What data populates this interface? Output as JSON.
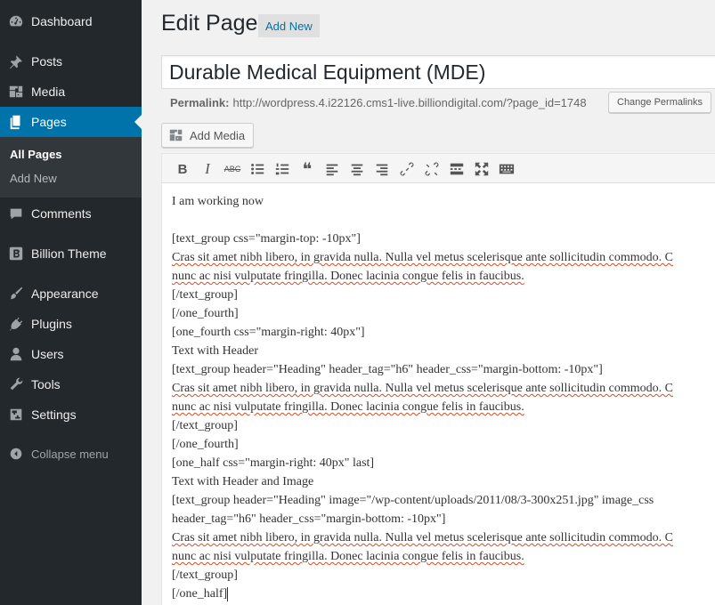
{
  "sidebar": {
    "items": [
      {
        "label": "Dashboard",
        "icon": "dashboard-icon"
      },
      {
        "label": "Posts",
        "icon": "pushpin-icon"
      },
      {
        "label": "Media",
        "icon": "media-icon"
      },
      {
        "label": "Pages",
        "icon": "pages-icon"
      },
      {
        "label": "Comments",
        "icon": "comment-icon"
      },
      {
        "label": "Billion Theme",
        "icon": "billion-b-icon"
      },
      {
        "label": "Appearance",
        "icon": "paintbrush-icon"
      },
      {
        "label": "Plugins",
        "icon": "plugin-icon"
      },
      {
        "label": "Users",
        "icon": "user-icon"
      },
      {
        "label": "Tools",
        "icon": "wrench-icon"
      },
      {
        "label": "Settings",
        "icon": "settings-sliders-icon"
      }
    ],
    "submenu": {
      "all_pages": "All Pages",
      "add_new": "Add New"
    },
    "collapse": "Collapse menu",
    "active_color": "#0073aa",
    "background": "#23282d"
  },
  "header": {
    "title": "Edit Page",
    "add_new": "Add New"
  },
  "post": {
    "title": "Durable Medical Equipment (MDE)",
    "permalink_label": "Permalink:",
    "permalink_url": "http://wordpress.4.i22126.cms1-live.billiondigital.com/?page_id=1748",
    "change_permalinks": "Change Permalinks"
  },
  "media": {
    "add_media": "Add Media"
  },
  "toolbar": {
    "buttons": [
      "bold",
      "italic",
      "strikethrough",
      "bulleted-list",
      "numbered-list",
      "blockquote",
      "align-left",
      "align-center",
      "align-right",
      "insert-link",
      "remove-link",
      "read-more",
      "fullscreen",
      "toolbar-toggle"
    ],
    "bold_glyph": "B",
    "italic_glyph": "I",
    "strike_glyph": "ABC",
    "quote_glyph": "❝"
  },
  "content": {
    "lines": [
      "I am working now",
      "",
      "[text_group css=\"margin-top: -10px\"]",
      "Cras sit amet nibh libero, in gravida nulla. Nulla vel metus scelerisque ante sollicitudin commodo. C",
      "nunc ac nisi vulputate fringilla. Donec lacinia congue felis in faucibus.",
      "[/text_group]",
      "[/one_fourth]",
      "[one_fourth css=\"margin-right: 40px\"]",
      "Text with Header",
      "[text_group header=\"Heading\" header_tag=\"h6\" header_css=\"margin-bottom: -10px\"]",
      "Cras sit amet nibh libero, in gravida nulla. Nulla vel metus scelerisque ante sollicitudin commodo. C",
      "nunc ac nisi vulputate fringilla. Donec lacinia congue felis in faucibus.",
      "[/text_group]",
      "[/one_fourth]",
      "[one_half css=\"margin-right: 40px\" last]",
      "Text with Header and Image",
      "[text_group header=\"Heading\" image=\"/wp-content/uploads/2011/08/3-300x251.jpg\" image_css",
      "header_tag=\"h6\" header_css=\"margin-bottom: -10px\"]",
      "Cras sit amet nibh libero, in gravida nulla. Nulla vel metus scelerisque ante sollicitudin commodo. C",
      "nunc ac nisi vulputate fringilla. Donec lacinia congue felis in faucibus.",
      "[/text_group]",
      "[/one_half]"
    ]
  }
}
